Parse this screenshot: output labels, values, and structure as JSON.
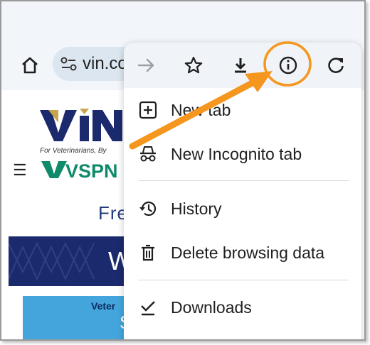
{
  "browser": {
    "url": "vin.co",
    "home_icon": "home-icon",
    "site_info_icon": "tune-icon"
  },
  "page": {
    "logo_vin": "VIN",
    "tagline": "For Veterinarians, By",
    "logo_vspn": "VSPN",
    "headline_fragment": "Fre",
    "banner_fragment": "W",
    "card_text": "Veter",
    "card_text2": "S"
  },
  "menu": {
    "toolbar": [
      {
        "name": "forward-icon",
        "enabled": false
      },
      {
        "name": "bookmark-star-icon",
        "enabled": true
      },
      {
        "name": "download-icon",
        "enabled": true
      },
      {
        "name": "info-icon",
        "enabled": true
      },
      {
        "name": "reload-icon",
        "enabled": true
      }
    ],
    "items": [
      {
        "label": "New tab",
        "icon": "new-tab-icon"
      },
      {
        "label": "New Incognito tab",
        "icon": "incognito-icon"
      },
      {
        "label": "History",
        "icon": "history-icon"
      },
      {
        "label": "Delete browsing data",
        "icon": "delete-icon"
      },
      {
        "label": "Downloads",
        "icon": "downloads-check-icon"
      }
    ]
  },
  "annotation": {
    "color": "#f5961e",
    "target": "info-icon"
  }
}
